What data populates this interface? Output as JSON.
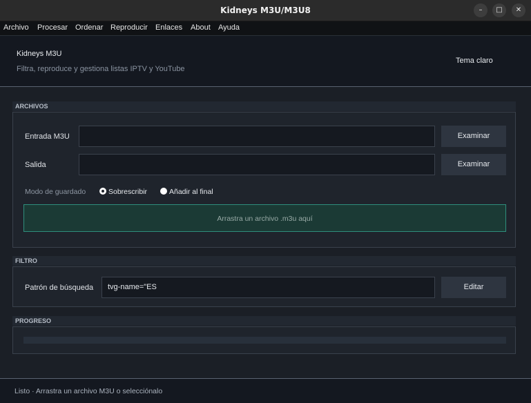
{
  "window": {
    "title": "Kidneys M3U/M3U8",
    "controls": [
      "minimize-icon",
      "maximize-icon",
      "close-icon"
    ]
  },
  "menu": [
    "Archivo",
    "Procesar",
    "Ordenar",
    "Reproducir",
    "Enlaces",
    "About",
    "Ayuda"
  ],
  "header": {
    "app_name": "Kidneys M3U",
    "subtitle": "Filtra, reproduce y gestiona listas IPTV y YouTube",
    "theme_button": "Tema claro"
  },
  "archivos": {
    "section_title": "ARCHIVOS",
    "input_label": "Entrada M3U",
    "input_value": "",
    "output_label": "Salida",
    "output_value": "",
    "browse_label": "Examinar",
    "save_mode_label": "Modo de guardado",
    "save_modes": [
      {
        "label": "Sobrescribir",
        "selected": true
      },
      {
        "label": "Añadir al final",
        "selected": false
      }
    ],
    "dropzone_text": "Arrastra un archivo .m3u aquí"
  },
  "filtro": {
    "section_title": "FILTRO",
    "pattern_label": "Patrón de búsqueda",
    "pattern_value": "tvg-name=\"ES",
    "edit_label": "Editar"
  },
  "progreso": {
    "section_title": "PROGRESO",
    "progress": 0
  },
  "status": {
    "text": "Listo · Arrastra un archivo M3U o selecciónalo"
  },
  "colors": {
    "accent": "#2f8f7d",
    "background": "#1b1f26"
  }
}
